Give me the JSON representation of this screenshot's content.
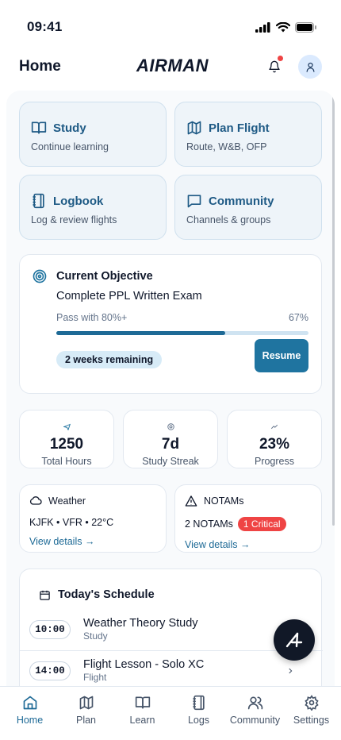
{
  "status": {
    "time": "09:41"
  },
  "header": {
    "title": "Home",
    "brand": "AIRMAN"
  },
  "tiles": [
    {
      "title": "Study",
      "subtitle": "Continue learning",
      "icon": "book-open-icon"
    },
    {
      "title": "Plan Flight",
      "subtitle": "Route, W&B, OFP",
      "icon": "map-icon"
    },
    {
      "title": "Logbook",
      "subtitle": "Log & review flights",
      "icon": "notebook-icon"
    },
    {
      "title": "Community",
      "subtitle": "Channels & groups",
      "icon": "chat-bubble-icon"
    }
  ],
  "objective": {
    "label": "Current Objective",
    "title": "Complete PPL Written Exam",
    "requirement": "Pass with 80%+",
    "progress_text": "67%",
    "progress_fraction": 0.67,
    "remaining": "2 weeks remaining",
    "resume_label": "Resume"
  },
  "stats": [
    {
      "value": "1250",
      "label": "Total Hours",
      "icon": "plane-icon"
    },
    {
      "value": "7d",
      "label": "Study Streak",
      "icon": "target-icon"
    },
    {
      "value": "23%",
      "label": "Progress",
      "icon": "trend-up-icon"
    }
  ],
  "weather": {
    "label": "Weather",
    "summary": "KJFK • VFR • 22°C",
    "link": "View details →"
  },
  "notams": {
    "label": "NOTAMs",
    "count_text": "2 NOTAMs",
    "critical": "1 Critical",
    "link": "View details →"
  },
  "schedule": {
    "title": "Today's Schedule",
    "items": [
      {
        "time": "10:00",
        "title": "Weather Theory Study",
        "type": "Study"
      },
      {
        "time": "14:00",
        "title": "Flight Lesson - Solo XC",
        "type": "Flight"
      }
    ]
  },
  "tabs": [
    {
      "label": "Home",
      "icon": "home-icon",
      "active": true
    },
    {
      "label": "Plan",
      "icon": "map-icon",
      "active": false
    },
    {
      "label": "Learn",
      "icon": "book-open-icon",
      "active": false
    },
    {
      "label": "Logs",
      "icon": "notebook-icon",
      "active": false
    },
    {
      "label": "Community",
      "icon": "users-icon",
      "active": false
    },
    {
      "label": "Settings",
      "icon": "gear-icon",
      "active": false
    }
  ],
  "colors": {
    "accent": "#1f74a0",
    "tile_bg": "#eef4f9",
    "critical": "#ef4444",
    "active_tab": "#1e6a96"
  }
}
